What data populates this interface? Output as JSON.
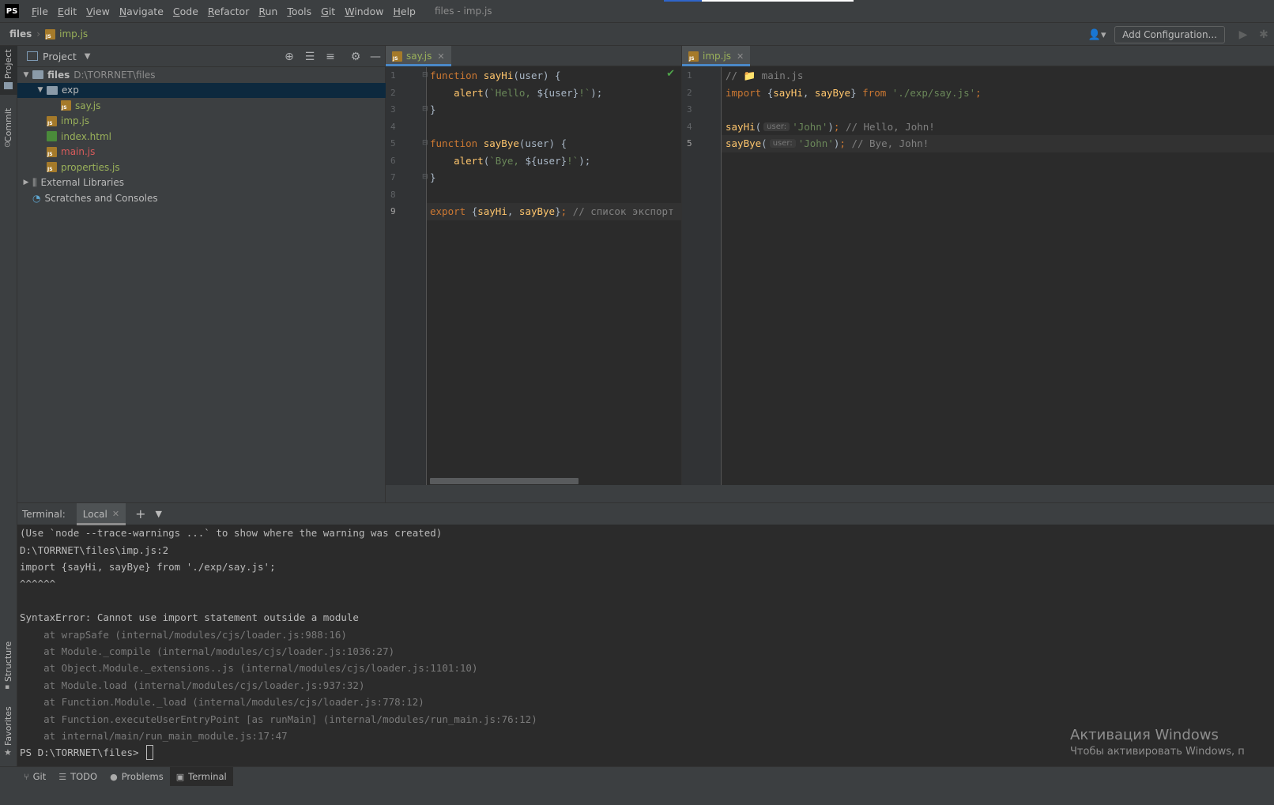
{
  "menu": {
    "logo": "PS",
    "items": [
      "File",
      "Edit",
      "View",
      "Navigate",
      "Code",
      "Refactor",
      "Run",
      "Tools",
      "Git",
      "Window",
      "Help"
    ],
    "window_title": "files - imp.js"
  },
  "navbar": {
    "root": "files",
    "file": "imp.js",
    "add_configuration": "Add Configuration..."
  },
  "left_stripe": {
    "project": "Project",
    "commit": "Commit",
    "structure": "Structure",
    "favorites": "Favorites"
  },
  "project_panel": {
    "title": "Project",
    "tree": [
      {
        "label": "files",
        "path": "D:\\TORRNET\\files",
        "type": "folder",
        "level": 0,
        "expanded": true
      },
      {
        "label": "exp",
        "type": "folder",
        "level": 1,
        "expanded": true,
        "selected": true
      },
      {
        "label": "say.js",
        "type": "js",
        "level": 2
      },
      {
        "label": "imp.js",
        "type": "js",
        "level": 1
      },
      {
        "label": "index.html",
        "type": "html",
        "level": 1
      },
      {
        "label": "main.js",
        "type": "js-error",
        "level": 1
      },
      {
        "label": "properties.js",
        "type": "js",
        "level": 1
      },
      {
        "label": "External Libraries",
        "type": "libs",
        "level": 0
      },
      {
        "label": "Scratches and Consoles",
        "type": "scratch",
        "level": 0
      }
    ]
  },
  "editor_left": {
    "tab": "say.js",
    "lines": [
      [
        [
          "kw",
          "function "
        ],
        [
          "fn",
          "sayHi"
        ],
        [
          "plain",
          "(user) {"
        ]
      ],
      [
        [
          "plain",
          "    "
        ],
        [
          "fn",
          "alert"
        ],
        [
          "plain",
          "("
        ],
        [
          "str",
          "`Hello, "
        ],
        [
          "plain",
          "${user}"
        ],
        [
          "str",
          "!`"
        ],
        [
          "plain",
          ");"
        ]
      ],
      [
        [
          "plain",
          "}"
        ]
      ],
      [],
      [
        [
          "kw",
          "function "
        ],
        [
          "fn",
          "sayBye"
        ],
        [
          "plain",
          "(user) {"
        ]
      ],
      [
        [
          "plain",
          "    "
        ],
        [
          "fn",
          "alert"
        ],
        [
          "plain",
          "("
        ],
        [
          "str",
          "`Bye, "
        ],
        [
          "plain",
          "${user}"
        ],
        [
          "str",
          "!`"
        ],
        [
          "plain",
          ");"
        ]
      ],
      [
        [
          "plain",
          "}"
        ]
      ],
      [],
      [
        [
          "kw",
          "export "
        ],
        [
          "plain",
          "{"
        ],
        [
          "fn",
          "sayHi"
        ],
        [
          "plain",
          ", "
        ],
        [
          "fn",
          "sayBye"
        ],
        [
          "plain",
          "}"
        ],
        [
          "kw",
          "; "
        ],
        [
          "cmt",
          "// список экспорт"
        ]
      ]
    ],
    "line_numbers": [
      "1",
      "2",
      "3",
      "4",
      "5",
      "6",
      "7",
      "8",
      "9"
    ]
  },
  "editor_right": {
    "tab": "imp.js",
    "lines": [
      [
        [
          "cmt",
          "// 📁 main.js"
        ]
      ],
      [
        [
          "kw",
          "import "
        ],
        [
          "plain",
          "{"
        ],
        [
          "fn",
          "sayHi"
        ],
        [
          "plain",
          ", "
        ],
        [
          "fn",
          "sayBye"
        ],
        [
          "plain",
          "} "
        ],
        [
          "kw",
          "from "
        ],
        [
          "str",
          "'./exp/say.js'"
        ],
        [
          "kw",
          ";"
        ]
      ],
      [],
      [
        [
          "fn",
          "sayHi"
        ],
        [
          "plain",
          "("
        ],
        [
          "hint",
          "user:"
        ],
        [
          "str",
          "'John'"
        ],
        [
          "plain",
          ")"
        ],
        [
          "kw",
          "; "
        ],
        [
          "cmt",
          "// Hello, John!"
        ]
      ],
      [
        [
          "fn",
          "sayBye"
        ],
        [
          "plain",
          "("
        ],
        [
          "hint",
          "user:"
        ],
        [
          "str",
          "'John'"
        ],
        [
          "plain",
          ")"
        ],
        [
          "kw",
          "; "
        ],
        [
          "cmt",
          "// Bye, John!"
        ]
      ]
    ],
    "line_numbers": [
      "1",
      "2",
      "3",
      "4",
      "5"
    ]
  },
  "terminal": {
    "title": "Terminal:",
    "tab": "Local",
    "lines": [
      {
        "text": "(Use `node --trace-warnings ...` to show where the warning was created)",
        "dim": false
      },
      {
        "text": "D:\\TORRNET\\files\\imp.js:2",
        "dim": false
      },
      {
        "text": "import {sayHi, sayBye} from './exp/say.js';",
        "dim": false
      },
      {
        "text": "^^^^^^",
        "dim": false
      },
      {
        "text": "",
        "dim": false
      },
      {
        "text": "SyntaxError: Cannot use import statement outside a module",
        "dim": false
      },
      {
        "text": "    at wrapSafe (internal/modules/cjs/loader.js:988:16)",
        "dim": true
      },
      {
        "text": "    at Module._compile (internal/modules/cjs/loader.js:1036:27)",
        "dim": true
      },
      {
        "text": "    at Object.Module._extensions..js (internal/modules/cjs/loader.js:1101:10)",
        "dim": true
      },
      {
        "text": "    at Module.load (internal/modules/cjs/loader.js:937:32)",
        "dim": true
      },
      {
        "text": "    at Function.Module._load (internal/modules/cjs/loader.js:778:12)",
        "dim": true
      },
      {
        "text": "    at Function.executeUserEntryPoint [as runMain] (internal/modules/run_main.js:76:12)",
        "dim": true
      },
      {
        "text": "    at internal/main/run_main_module.js:17:47",
        "dim": true
      }
    ],
    "prompt": "PS D:\\TORRNET\\files> "
  },
  "windows_activation": {
    "title": "Активация Windows",
    "subtitle": "Чтобы активировать Windows, п"
  },
  "statusbar": {
    "tabs": [
      "Git",
      "TODO",
      "Problems",
      "Terminal"
    ],
    "active": "Terminal"
  }
}
